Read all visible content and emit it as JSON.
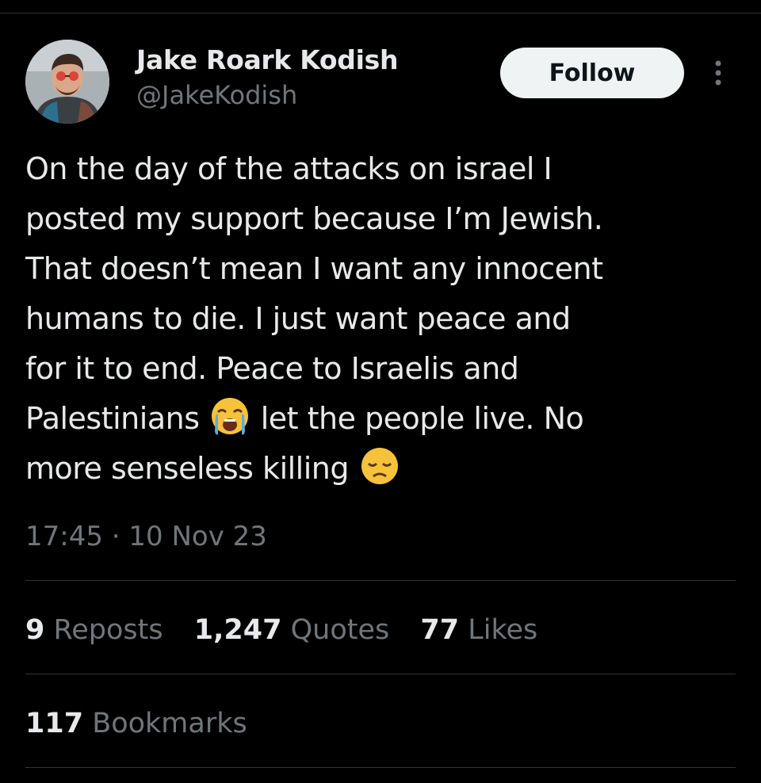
{
  "tweet": {
    "author": {
      "display_name": "Jake Roark Kodish",
      "handle": "@JakeKodish",
      "avatar_icon": "user-avatar"
    },
    "follow_label": "Follow",
    "more_icon": "more-vertical-icon",
    "text_lines": [
      "On the day of the attacks on israel I",
      "posted my support because I’m Jewish.",
      "That doesn’t mean I want any innocent",
      "humans to die. I just want peace and",
      "for it to end. Peace to Israelis and",
      [
        "Palestinians",
        "let the people live. No"
      ],
      "more senseless killing"
    ],
    "emojis": [
      "loudly-crying-face",
      "disappointed-face"
    ],
    "timestamp": "17:45 · 10 Nov 23",
    "stats": {
      "reposts_count": "9",
      "reposts_label": "Reposts",
      "quotes_count": "1,247",
      "quotes_label": "Quotes",
      "likes_count": "77",
      "likes_label": "Likes",
      "bookmarks_count": "117",
      "bookmarks_label": "Bookmarks"
    }
  },
  "colors": {
    "background": "#000000",
    "primary_text": "#e7e9ea",
    "secondary_text": "#71767b",
    "divider": "#2f3336",
    "follow_bg": "#eff3f4",
    "follow_text": "#0f1419"
  }
}
